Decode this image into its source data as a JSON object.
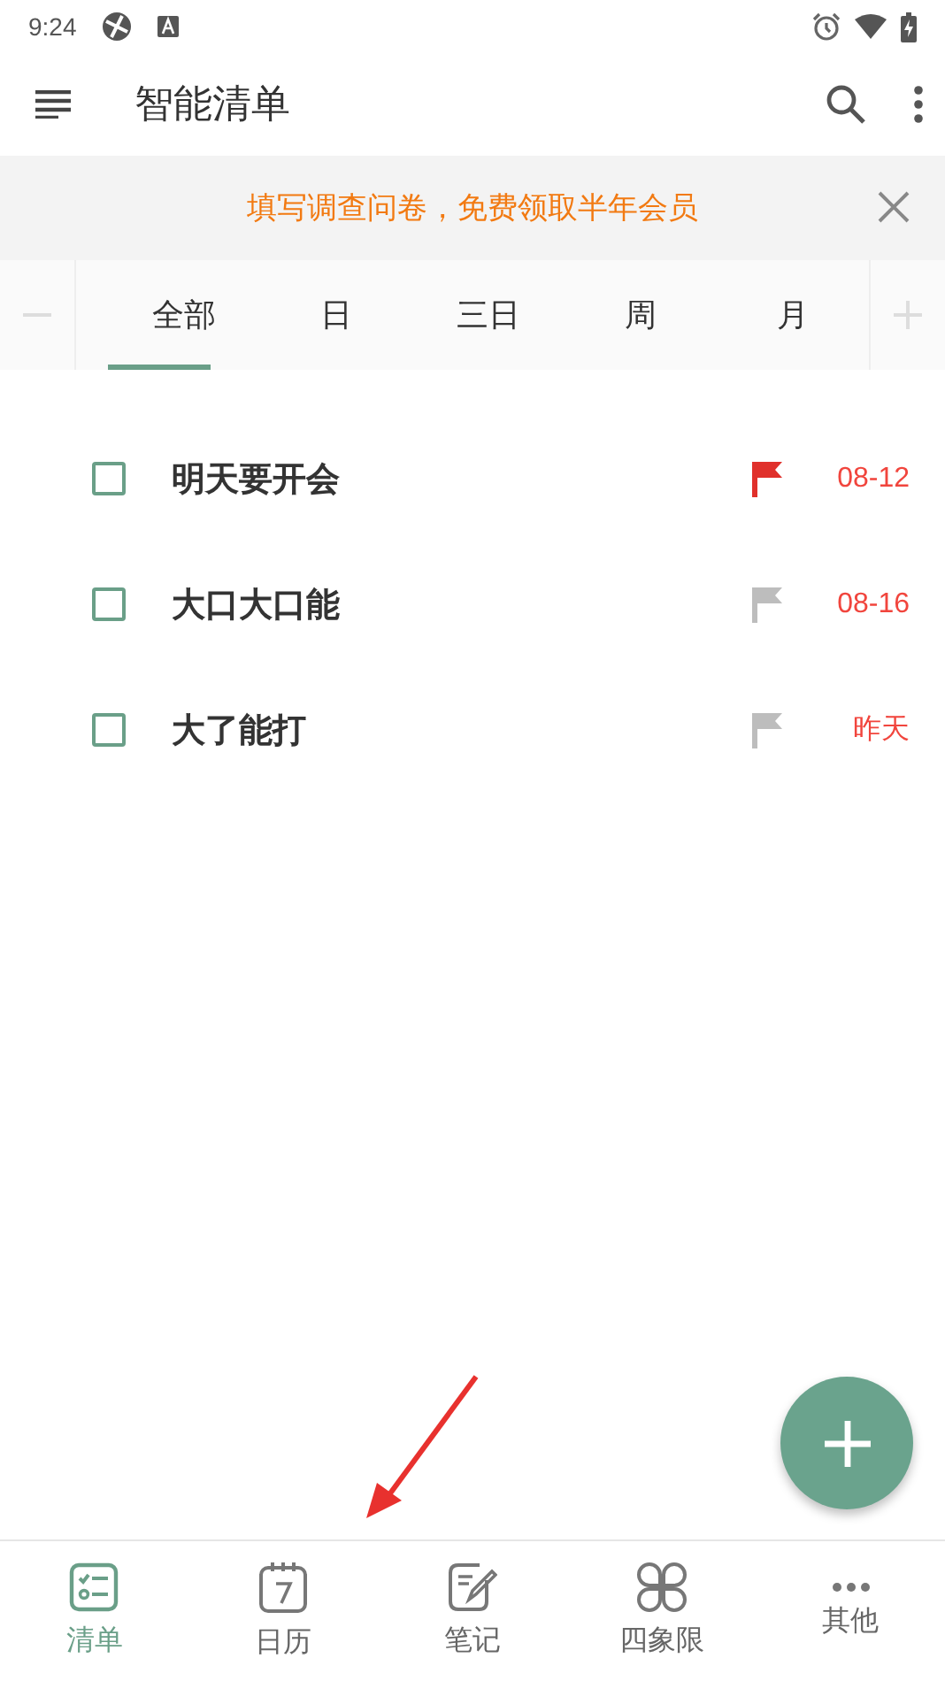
{
  "status_bar": {
    "time": "9:24"
  },
  "app_bar": {
    "title": "智能清单"
  },
  "banner": {
    "text": "填写调查问卷，免费领取半年会员"
  },
  "tabs": [
    {
      "label": "全部",
      "selected": true
    },
    {
      "label": "日",
      "selected": false
    },
    {
      "label": "三日",
      "selected": false
    },
    {
      "label": "周",
      "selected": false
    },
    {
      "label": "月",
      "selected": false
    }
  ],
  "tasks": [
    {
      "title": "明天要开会",
      "checked": false,
      "flagged": true,
      "due": "08-12"
    },
    {
      "title": "大口大口能",
      "checked": false,
      "flagged": false,
      "due": "08-16"
    },
    {
      "title": "大了能打",
      "checked": false,
      "flagged": false,
      "due": "昨天"
    }
  ],
  "annotations": [
    {
      "kind": "arrow",
      "color": "#e8312e"
    }
  ],
  "bottom_nav": [
    {
      "label": "清单",
      "kind": "list",
      "selected": true
    },
    {
      "label": "日历",
      "kind": "calendar",
      "selected": false
    },
    {
      "label": "笔记",
      "kind": "note",
      "selected": false
    },
    {
      "label": "四象限",
      "kind": "quadrant",
      "selected": false
    },
    {
      "label": "其他",
      "kind": "more",
      "selected": false
    }
  ]
}
